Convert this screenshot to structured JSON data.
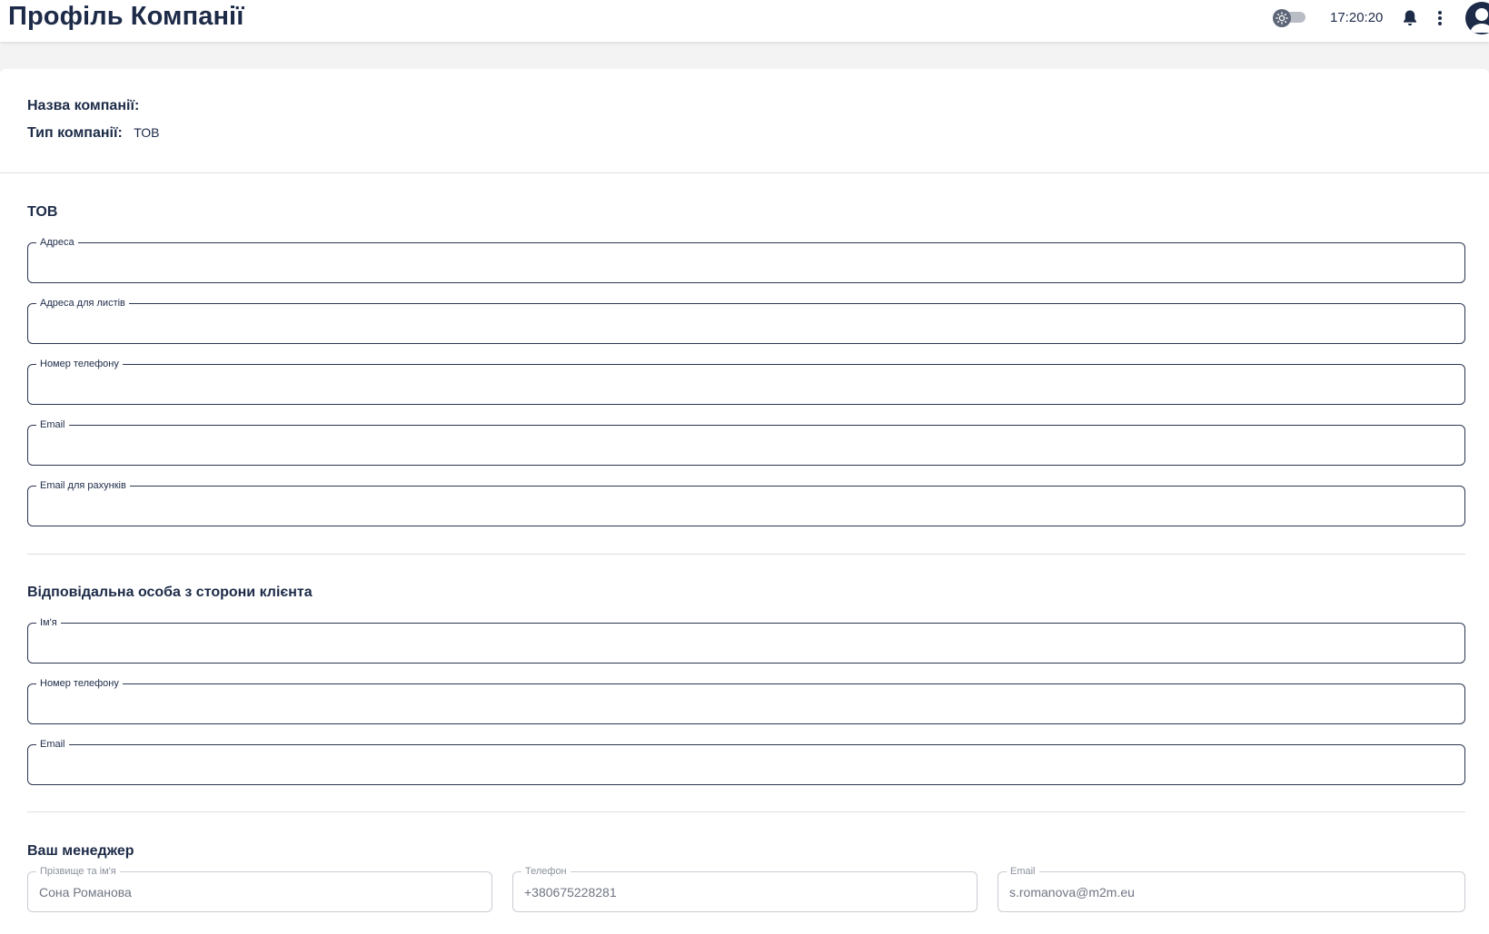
{
  "header": {
    "title": "Профіль Компанії",
    "time": "17:20:20",
    "icons": {
      "theme": "sun-icon",
      "notifications": "bell-icon",
      "menu": "more-vertical-icon",
      "avatar": "user-avatar-icon"
    }
  },
  "company": {
    "name_label": "Назва компанії:",
    "name_value": "",
    "type_label": "Тип компанії:",
    "type_value": "ТОВ"
  },
  "section_company": {
    "title": "ТОВ",
    "fields": {
      "address": {
        "label": "Адреса",
        "value": ""
      },
      "mail_address": {
        "label": "Адреса для листів",
        "value": ""
      },
      "phone": {
        "label": "Номер телефону",
        "value": ""
      },
      "email": {
        "label": "Email",
        "value": ""
      },
      "billing_email": {
        "label": "Email для рахунків",
        "value": ""
      }
    }
  },
  "section_contact": {
    "title": "Відповідальна особа з сторони клієнта",
    "fields": {
      "name": {
        "label": "Ім'я",
        "value": ""
      },
      "phone": {
        "label": "Номер телефону",
        "value": ""
      },
      "email": {
        "label": "Email",
        "value": ""
      }
    }
  },
  "section_manager": {
    "title": "Ваш менеджер",
    "fields": {
      "full_name": {
        "label": "Прізвище та ім'я",
        "value": "Сона Романова"
      },
      "phone": {
        "label": "Телефон",
        "value": "+380675228281"
      },
      "email": {
        "label": "Email",
        "value": "s.romanova@m2m.eu"
      }
    }
  },
  "colors": {
    "primary_text": "#1d2b48",
    "border_active": "#2b3650",
    "border_disabled": "#c9ccd3"
  }
}
